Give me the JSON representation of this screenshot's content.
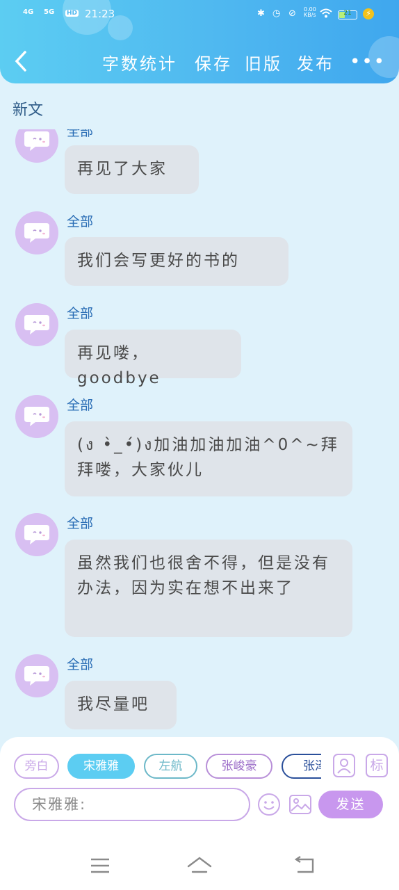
{
  "status_bar": {
    "sig1": "4G",
    "sig2": "5G",
    "hd": "HD",
    "time": "21:23",
    "net_speed": "0.00",
    "net_unit": "KB/s",
    "battery": "21"
  },
  "header": {
    "actions": [
      "字数统计",
      "保存",
      "旧版",
      "发布"
    ],
    "more": "•••"
  },
  "subbar": {
    "title": "新文"
  },
  "messages": [
    {
      "name": "全部",
      "text": "再见了大家"
    },
    {
      "name": "全部",
      "text": "我们会写更好的书的"
    },
    {
      "name": "全部",
      "text": "再见喽，goodbye"
    },
    {
      "name": "全部",
      "text": "(ง •̀_•́)ง加油加油加油^0^~拜拜喽，大家伙儿"
    },
    {
      "name": "全部",
      "text": "虽然我们也很舍不得，但是没有办法，因为实在想不出来了"
    },
    {
      "name": "全部",
      "text": "我尽量吧"
    }
  ],
  "roles": [
    "旁白",
    "宋雅雅",
    "左航",
    "张峻豪",
    "张泽"
  ],
  "panel": {
    "mark_label": "标",
    "input_value": "宋雅雅:",
    "send_label": "发送"
  },
  "colors": {
    "header": "#4fb8f0",
    "accent": "#c897ee",
    "name": "#2a6db5",
    "bubble": "#dfe4ea"
  }
}
